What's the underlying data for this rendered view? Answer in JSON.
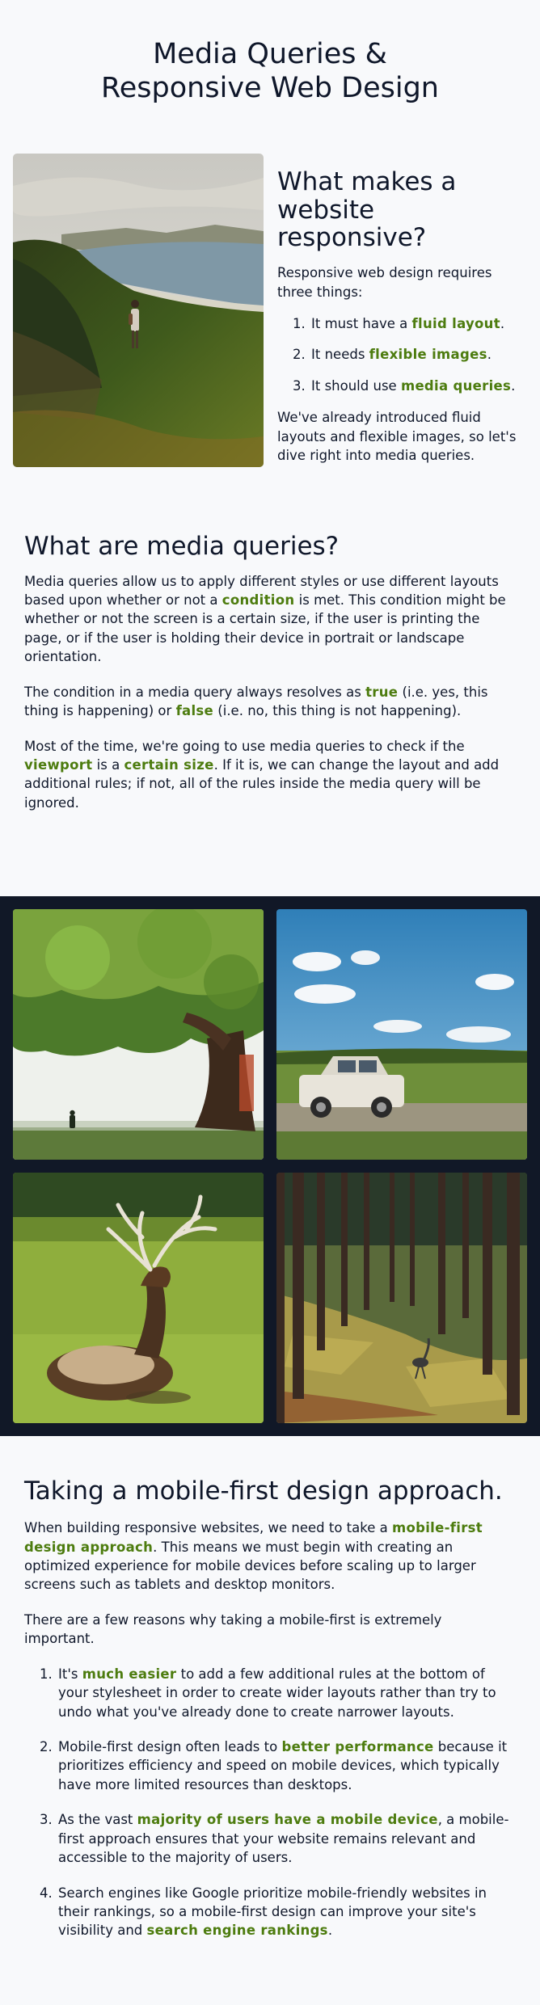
{
  "page": {
    "title_line1": "Media Queries &",
    "title_line2": "Responsive Web Design"
  },
  "intro": {
    "image_alt": "Hiker standing on a grassy coastal cliff overlooking the sea",
    "heading": "What makes a website responsive?",
    "lead": "Responsive web design requires three things:",
    "items": [
      {
        "pre": "It must have a ",
        "hl": "fluid layout",
        "post": "."
      },
      {
        "pre": "It needs ",
        "hl": "flexible images",
        "post": "."
      },
      {
        "pre": "It should use ",
        "hl": "media queries",
        "post": "."
      }
    ],
    "outro": "We've already introduced fluid layouts and flexible images, so let's dive right into media queries."
  },
  "media_queries": {
    "heading": "What are media queries?",
    "p1_pre": "Media queries allow us to apply different styles or use different layouts based upon whether or not a ",
    "p1_hl": "condition",
    "p1_post": " is met. This condition might be whether or not the screen is a certain size, if the user is printing the page, or if the user is holding their device in portrait or landscape orientation.",
    "p2_pre": "The condition in a media query always resolves as ",
    "p2_hl1": "true",
    "p2_mid": " (i.e. yes, this thing is happening) or ",
    "p2_hl2": "false",
    "p2_post": " (i.e. no, this thing is not happening).",
    "p3_pre": "Most of the time, we're going to use media queries to check if the ",
    "p3_hl1": "viewport",
    "p3_mid": " is a ",
    "p3_hl2": "certain size",
    "p3_post": ". If it is, we can change the layout and add additional rules; if not, all of the rules inside the media query will be ignored."
  },
  "gallery": {
    "images": [
      "Large tree with a lone person standing in a bright meadow",
      "White SUV parked on a grassy field under a blue sky",
      "Elk with large antlers resting in a green pasture",
      "Bird walking through a sunlit pine forest"
    ]
  },
  "mobile_first": {
    "heading": "Taking a mobile-first design approach.",
    "p1_pre": "When building responsive websites, we need to take a ",
    "p1_hl": "mobile-first design approach",
    "p1_post": ". This means we must begin with creating an optimized experience for mobile devices before scaling up to larger screens such as tablets and desktop monitors.",
    "p2": "There are a few reasons why taking a mobile-first is extremely important.",
    "items": [
      {
        "pre": "It's ",
        "hl": "much easier",
        "post": " to add a few additional rules at the bottom of your stylesheet in order to create wider layouts rather than try to undo what you've already done to create narrower layouts."
      },
      {
        "pre": "Mobile-first design often leads to ",
        "hl": "better performance",
        "post": " because it prioritizes efficiency and speed on mobile devices, which typically have more limited resources than desktops."
      },
      {
        "pre": "As the vast ",
        "hl": "majority of users have a mobile device",
        "post": ", a mobile-first approach ensures that your website remains relevant and accessible to the majority of users."
      },
      {
        "pre": "Search engines like Google prioritize mobile-friendly websites in their rankings, so a mobile-first design can improve your site's visibility and ",
        "hl": "search engine rankings",
        "post": "."
      }
    ]
  },
  "colors": {
    "background": "#f8f9fb",
    "text": "#0f172a",
    "highlight": "#4d7c0f",
    "gallery_band": "#111827"
  }
}
